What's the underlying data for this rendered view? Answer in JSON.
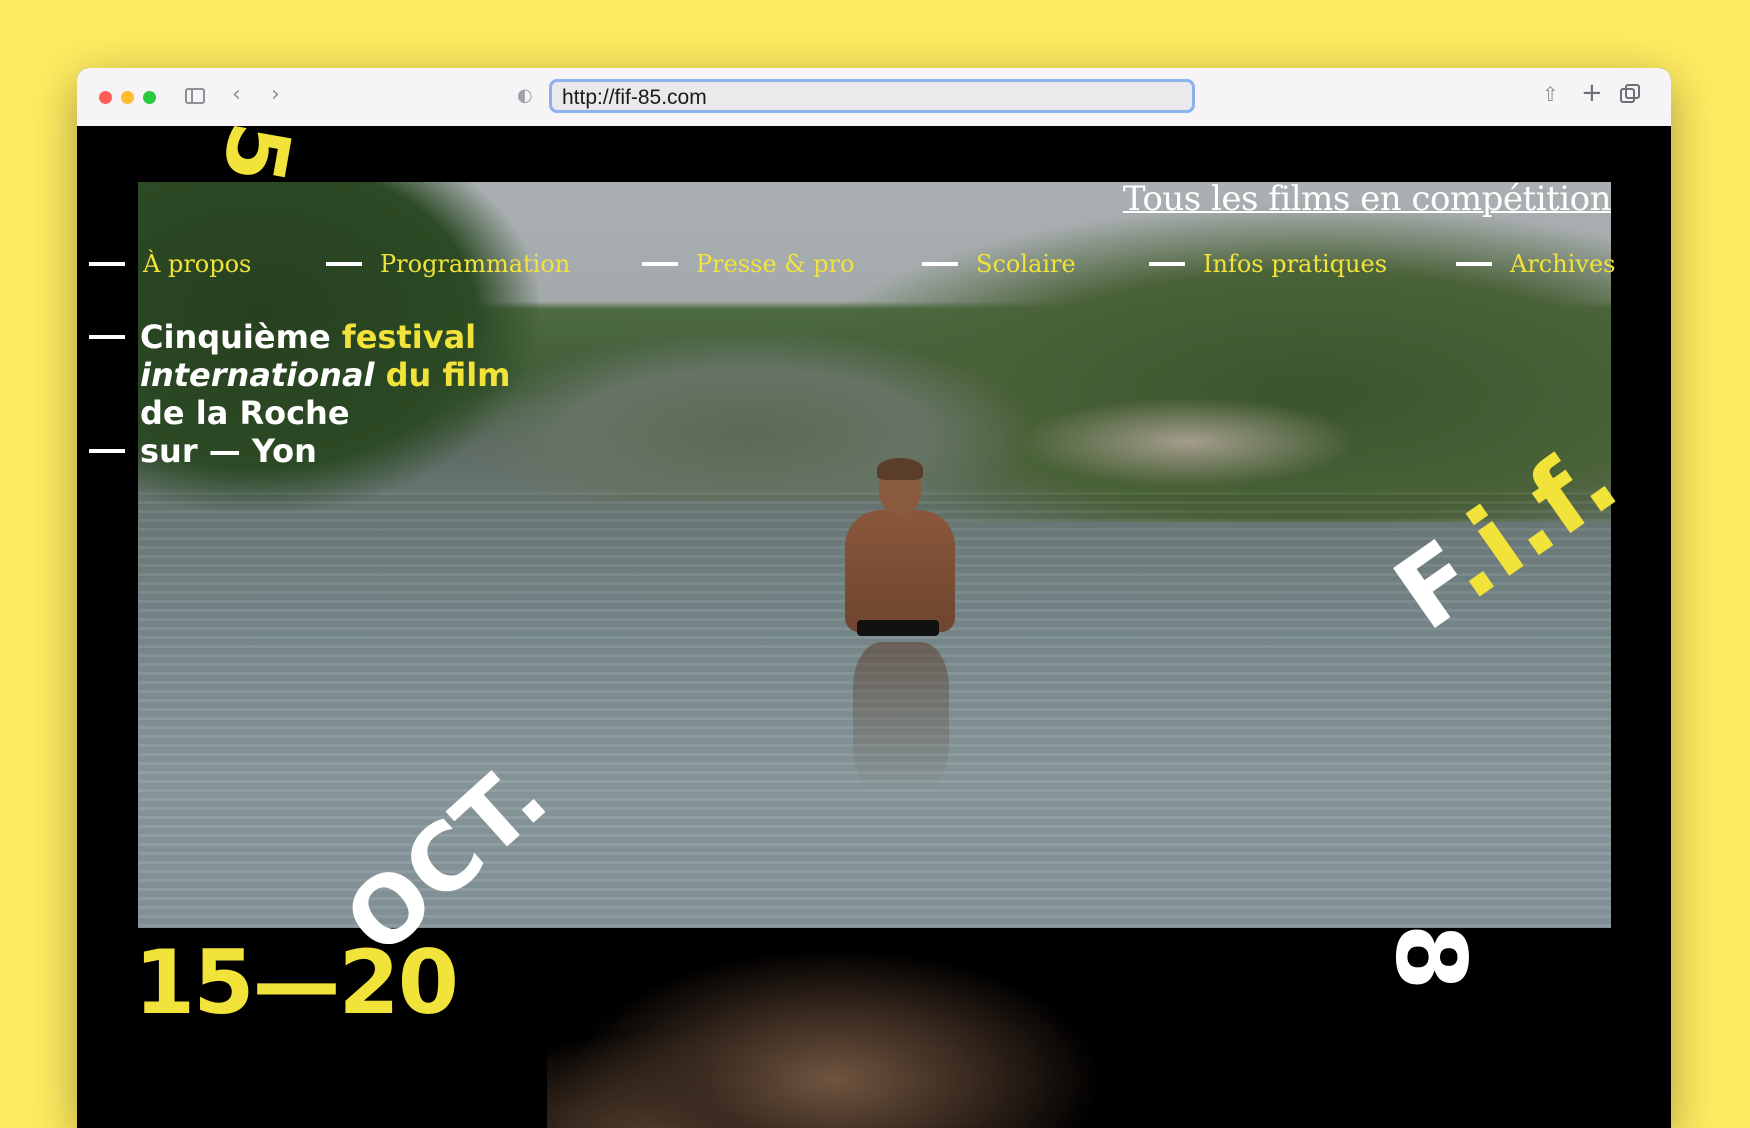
{
  "browser": {
    "url": "http://fif-85.com"
  },
  "page": {
    "top_link": "Tous les films en compétition",
    "nav": [
      {
        "label": "À propos"
      },
      {
        "label": "Programmation"
      },
      {
        "label": "Presse & pro"
      },
      {
        "label": "Scolaire"
      },
      {
        "label": "Infos pratiques"
      },
      {
        "label": "Archives"
      }
    ],
    "title": {
      "line1_a": "Cinquième",
      "line1_b": "festival",
      "line2_a": "international",
      "line2_b": "du film",
      "line3": "de la Roche",
      "line4": "sur — Yon"
    },
    "graphics": {
      "number_five": "5",
      "fif_part1": "F",
      "fif_part2": ".i.",
      "fif_part3": "f",
      "fif_part4": ".",
      "oct": "OCT.",
      "dates": "15—20",
      "number_eight": "8"
    }
  },
  "colors": {
    "background": "#FFEC61",
    "accent_yellow": "#F2E33A",
    "site_bg": "#000000"
  }
}
